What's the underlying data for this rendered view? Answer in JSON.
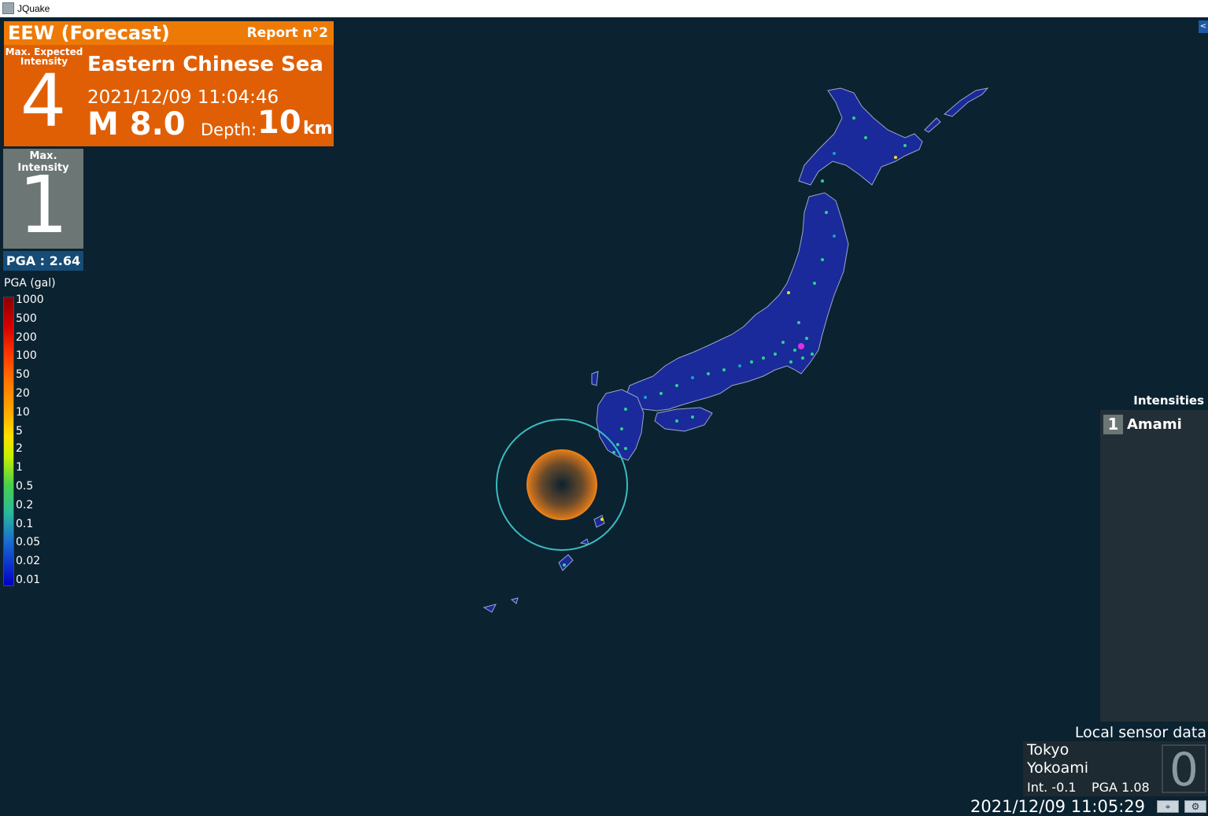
{
  "window": {
    "title": "JQuake",
    "icon": "seismograph-icon"
  },
  "eew": {
    "title": "EEW (Forecast)",
    "report": "Report n°2",
    "max_expected_label": "Max. Expected Intensity",
    "max_expected_intensity": "4",
    "region": "Eastern Chinese Sea",
    "datetime": "2021/12/09 11:04:46",
    "magnitude": "M 8.0",
    "depth_label": "Depth:",
    "depth_value": "10",
    "depth_unit": "km",
    "color": "#e05f05"
  },
  "observed": {
    "max_intensity_label": "Max. Intensity",
    "max_intensity": "1",
    "pga": "PGA : 2.64"
  },
  "legend": {
    "title": "PGA (gal)",
    "ticks": [
      "1000",
      "500",
      "200",
      "100",
      "50",
      "20",
      "10",
      "5",
      "2",
      "1",
      "0.5",
      "0.2",
      "0.1",
      "0.05",
      "0.02",
      "0.01"
    ]
  },
  "intensities": {
    "title": "Intensities",
    "items": [
      {
        "intensity": "1",
        "region": "Amami"
      }
    ]
  },
  "local_sensor": {
    "title": "Local sensor data",
    "city": "Tokyo",
    "station": "Yokoami",
    "intensity": "Int. -0.1",
    "pga": "PGA  1.08",
    "shindo": "0"
  },
  "clock": "2021/12/09 11:05:29",
  "buttons": {
    "collapse": "<",
    "locate_icon": "crosshair-icon",
    "settings_icon": "gear-icon"
  },
  "map": {
    "background": "#0b2230",
    "land_color": "#1a2a9a",
    "border_color": "#9aa6c8",
    "p_wave_color": "#3bbcc0",
    "s_wave_color": "#e8801a"
  }
}
